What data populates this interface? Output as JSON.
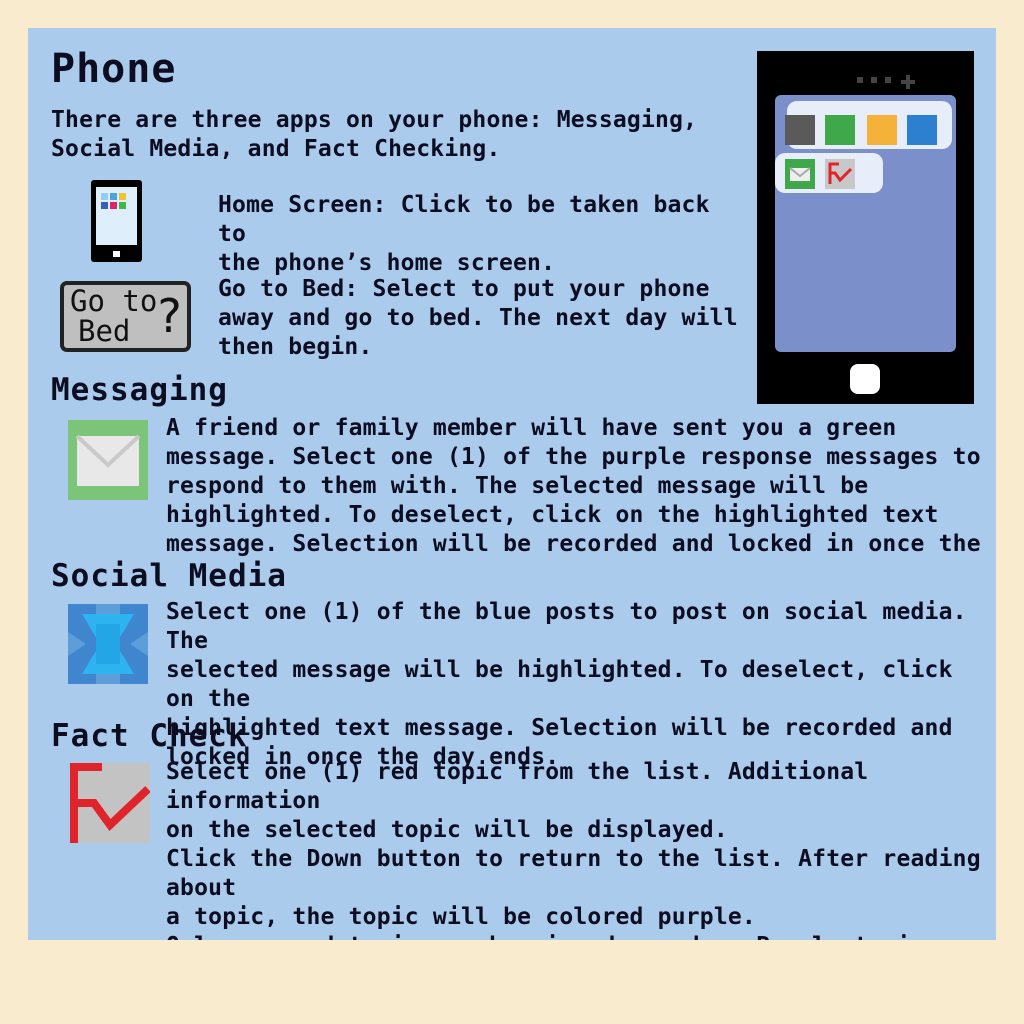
{
  "phone": {
    "title": "Phone",
    "intro": "There are three apps on your phone: Messaging,\nSocial Media, and Fact Checking.",
    "home_screen_text": "Home Screen: Click to be taken back to\nthe phone’s home screen.",
    "go_to_bed_button": {
      "line1": "Go to",
      "line2": "Bed",
      "mark": "?"
    },
    "go_to_bed_text": "Go to Bed: Select to put your phone\naway and go to bed. The next day will\nthen begin."
  },
  "messaging": {
    "title": "Messaging",
    "text": "A friend or family member will have sent you a green\nmessage. Select one (1) of the purple response messages to\nrespond to them with. The selected message will be\nhighlighted. To deselect, click on the highlighted text\nmessage. Selection will be recorded and locked in once the"
  },
  "social_media": {
    "title": "Social Media",
    "text": "Select one (1) of the blue posts to post on social media. The\nselected message will be highlighted. To deselect, click on the\nhighlighted text message. Selection will be recorded and\nlocked in once the day ends."
  },
  "fact_check": {
    "title": "Fact Check",
    "text": "Select one (1) red topic from the list. Additional information\non the selected topic will be displayed.\nClick the Down button to return to the list. After reading about\na topic, the topic will be colored purple.\nOnly one red topic can be viewed per day. Purple topics can be\nre-read. All topics will be available the next day."
  },
  "icons": {
    "small_phone": "phone-icon",
    "go_to_bed": "go-to-bed-icon",
    "messaging": "envelope-icon",
    "social_media": "social-media-icon",
    "fact_check": "fact-check-icon",
    "big_phone": "phone-illustration"
  },
  "colors": {
    "page_background": "#f9ebcd",
    "panel_background": "#abcbec",
    "phone_screen": "#7b8fcb",
    "messaging_green": "#7cc47a",
    "social_blue": "#2fa8ea",
    "fact_check_red": "#e0242c"
  }
}
